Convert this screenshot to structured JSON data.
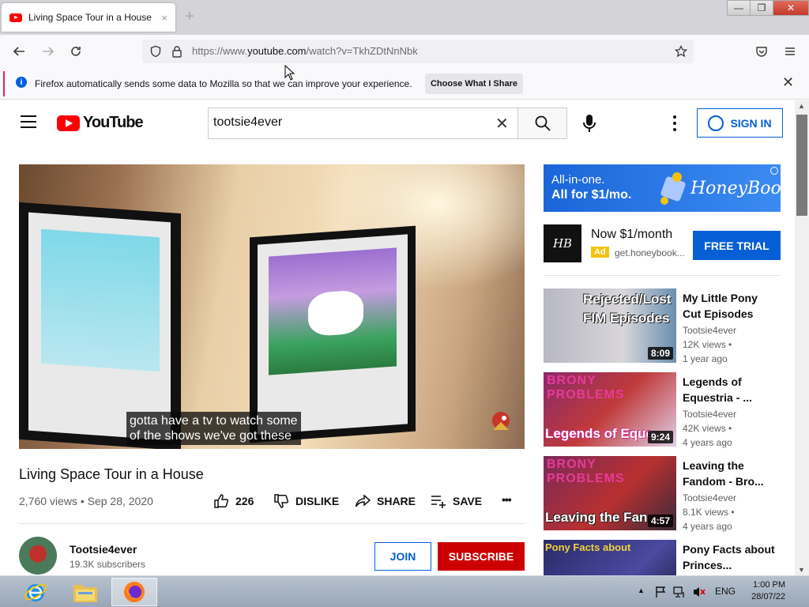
{
  "browser": {
    "tab_title": "Living Space Tour in a House - Yo",
    "tab_close": "×",
    "new_tab": "+",
    "url_prefix": "https://www.",
    "url_domain": "youtube.com",
    "url_suffix": "/watch?v=TkhZDtNnNbk",
    "notification_text": "Firefox automatically sends some data to Mozilla so that we can improve your experience.",
    "notification_button": "Choose What I Share",
    "notification_close": "✕",
    "window_buttons": [
      "—",
      "❐",
      "✕"
    ]
  },
  "youtube": {
    "logo_text": "YouTube",
    "search_value": "tootsie4ever",
    "search_clear": "✕",
    "signin_label": "SIGN IN",
    "video": {
      "captions_line1": "gotta have a tv to watch some",
      "captions_line2": "of the shows we've got these",
      "title": "Living Space Tour in a House",
      "meta": "2,760 views • Sep 28, 2020",
      "likes": "226",
      "dislike_label": "DISLIKE",
      "share_label": "SHARE",
      "save_label": "SAVE",
      "more_label": "•••"
    },
    "channel": {
      "name": "Tootsie4ever",
      "subscribers": "19.3K subscribers",
      "join_label": "JOIN",
      "subscribe_label": "SUBSCRIBE"
    },
    "ad": {
      "banner_line1": "All-in-one.",
      "banner_line2": "All for $1/mo.",
      "banner_brand": "HoneyBook",
      "logo_text": "HB",
      "headline": "Now $1/month",
      "badge": "Ad",
      "url": "get.honeybook...",
      "cta": "FREE TRIAL"
    },
    "recommendations": [
      {
        "title": "My Little Pony Cut Episodes",
        "channel": "Tootsie4ever",
        "views": "12K views •",
        "age": "1 year ago",
        "duration": "8:09",
        "thumb_text_1": "Rejected/Lost",
        "thumb_text_2": "FIM Episodes"
      },
      {
        "title": "Legends of Equestria - ...",
        "channel": "Tootsie4ever",
        "views": "42K views •",
        "age": "4 years ago",
        "duration": "9:24",
        "thumb_text_1": "BRONY PROBLEMS",
        "thumb_text_2": "Legends of Eque"
      },
      {
        "title": "Leaving the Fandom - Bro...",
        "channel": "Tootsie4ever",
        "views": "8.1K views •",
        "age": "4 years ago",
        "duration": "4:57",
        "thumb_text_1": "BRONY PROBLEMS",
        "thumb_text_2": "Leaving the Fan"
      },
      {
        "title": "Pony Facts about Princes...",
        "thumb_text_1": "Pony Facts about"
      }
    ]
  },
  "taskbar": {
    "language": "ENG",
    "time": "1:00 PM",
    "date": "28/07/22"
  },
  "colors": {
    "youtube_red": "#ff0000",
    "link_blue": "#065fd4",
    "subscribe_red": "#cc0000",
    "ad_yellow": "#f4c20d"
  }
}
